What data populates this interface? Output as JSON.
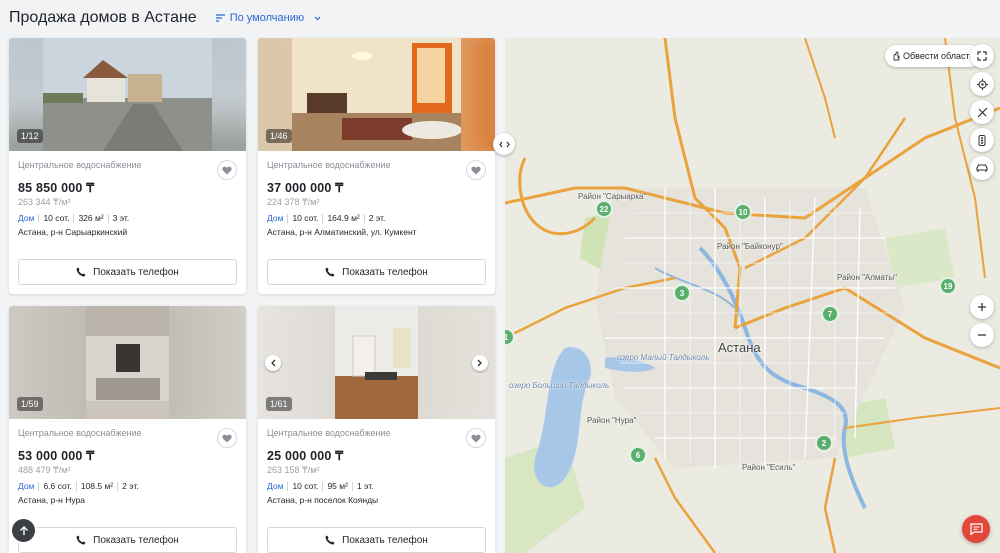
{
  "header": {
    "title": "Продажа домов в Астане",
    "sort_label": "По умолчанию"
  },
  "listings": [
    {
      "counter": "1/12",
      "feature": "Центральное водоснабжение",
      "price": "85 850 000 ₸",
      "ppm": "263 344 ₸/м²",
      "type": "Дом",
      "area_land": "10 сот.",
      "area": "326 м²",
      "floors": "3 эт.",
      "address": "Астана, р-н Сарыаркинский",
      "phone_btn": "Показать телефон",
      "has_arrows": false
    },
    {
      "counter": "1/46",
      "feature": "Центральное водоснабжение",
      "price": "37 000 000 ₸",
      "ppm": "224 378 ₸/м²",
      "type": "Дом",
      "area_land": "10 сот.",
      "area": "164.9 м²",
      "floors": "2 эт.",
      "address": "Астана, р-н Алматинский, ул. Кумкент",
      "phone_btn": "Показать телефон",
      "has_arrows": false
    },
    {
      "counter": "1/59",
      "feature": "Центральное водоснабжение",
      "price": "53 000 000 ₸",
      "ppm": "488 479 ₸/м²",
      "type": "Дом",
      "area_land": "6.6 сот.",
      "area": "108.5 м²",
      "floors": "2 эт.",
      "address": "Астана, р-н Нура",
      "phone_btn": "Показать телефон",
      "has_arrows": false
    },
    {
      "counter": "1/61",
      "feature": "Центральное водоснабжение",
      "price": "25 000 000 ₸",
      "ppm": "263 158 ₸/м²",
      "type": "Дом",
      "area_land": "10 сот.",
      "area": "95 м²",
      "floors": "1 эт.",
      "address": "Астана, р-н поселок Коянды",
      "phone_btn": "Показать телефон",
      "has_arrows": true
    }
  ],
  "map": {
    "outline_btn": "Обвести область",
    "city": "Астана",
    "labels": [
      "Район \"Сарыарка\"",
      "Район \"Байконур\"",
      "Район \"Алматы\"",
      "Район \"Нура\"",
      "Район \"Есиль\"",
      "озеро Малый Талдыколь",
      "озеро Большой Талдыколь"
    ],
    "clusters": [
      "22",
      "10",
      "3",
      "7",
      "19",
      "6",
      "2",
      "1"
    ]
  },
  "colors": {
    "accent": "#2a66d6",
    "cluster": "#5aaf6c",
    "chat": "#e2473a"
  }
}
